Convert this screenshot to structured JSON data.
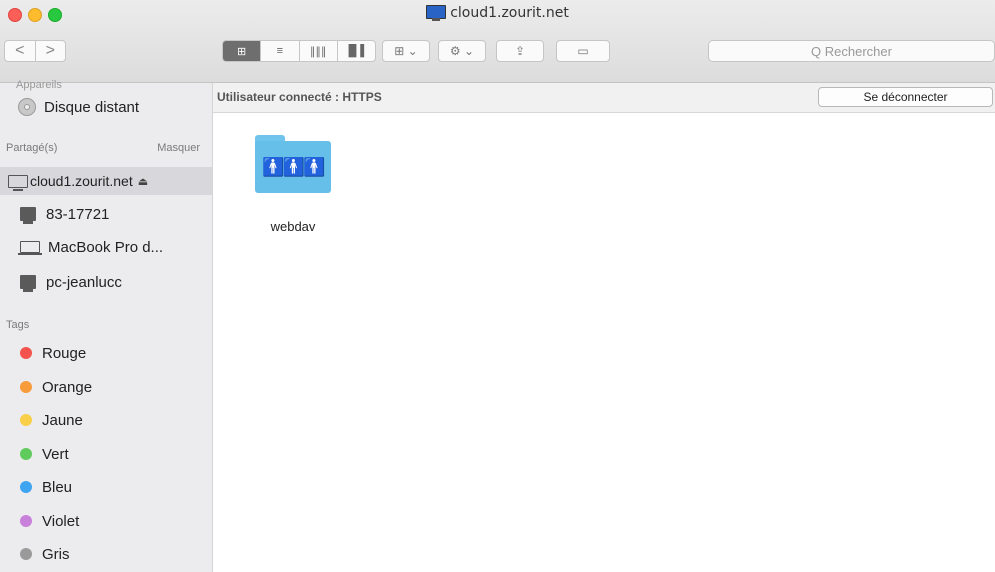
{
  "window": {
    "title": "cloud1.zourit.net"
  },
  "toolbar": {
    "back": "<",
    "forward": ">",
    "view_icons": "⊞",
    "view_list": "≡",
    "view_columns": "∥∥∥",
    "view_coverflow": "▐▌▌",
    "arrange": "⊞ ⌄",
    "action": "⚙ ⌄",
    "share": "⇪",
    "tag": "▭",
    "search_placeholder": "Q Rechercher"
  },
  "sidebar": {
    "partial_header": "Appareils",
    "device": "Disque distant",
    "shared_header": "Partagé(s)",
    "shared_hide": "Masquer",
    "shared": [
      {
        "label": "cloud1.zourit.net",
        "eject": "⏏"
      },
      {
        "label": "83-17721"
      },
      {
        "label": "MacBook Pro d..."
      },
      {
        "label": "pc-jeanlucc"
      }
    ],
    "tags_header": "Tags",
    "tags": [
      {
        "label": "Rouge",
        "color": "#f4524d"
      },
      {
        "label": "Orange",
        "color": "#f89b3a"
      },
      {
        "label": "Jaune",
        "color": "#f9cf4a"
      },
      {
        "label": "Vert",
        "color": "#5fcb5c"
      },
      {
        "label": "Bleu",
        "color": "#3fa5f1"
      },
      {
        "label": "Violet",
        "color": "#c880da"
      },
      {
        "label": "Gris",
        "color": "#9a9a9a"
      }
    ]
  },
  "pathbar": {
    "status": "Utilisateur connecté : HTTPS",
    "disconnect": "Se déconnecter"
  },
  "content": {
    "folder_label": "webdav"
  }
}
